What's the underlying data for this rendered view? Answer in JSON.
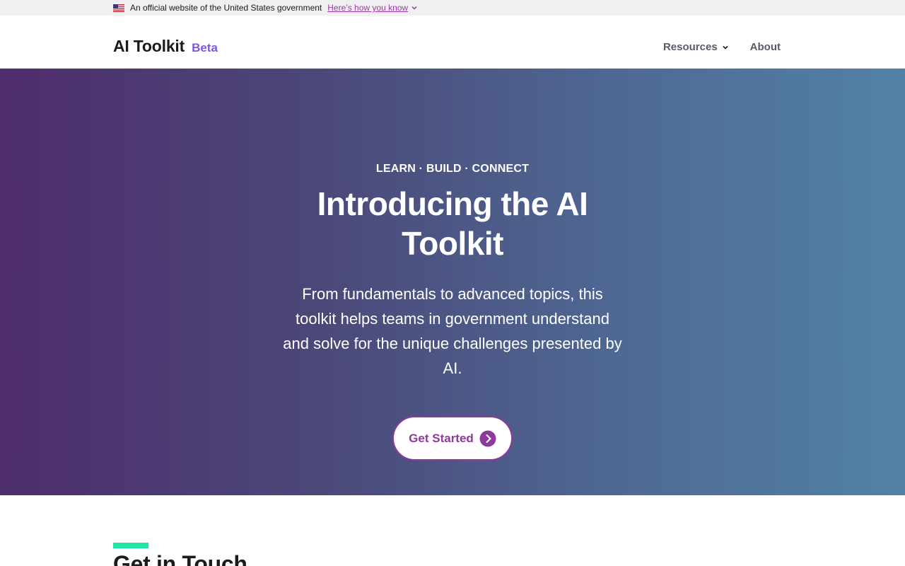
{
  "gov_banner": {
    "text": "An official website of the United States government",
    "link": "Here’s how you know",
    "flag_icon": "us-flag-icon",
    "chevron_icon": "chevron-down-icon"
  },
  "header": {
    "title": "AI Toolkit",
    "badge": "Beta",
    "nav": [
      {
        "label": "Resources",
        "icon": "chevron-down-icon"
      },
      {
        "label": "About"
      }
    ]
  },
  "hero": {
    "eyebrow": "LEARN · BUILD · CONNECT",
    "title": "Introducing the AI Toolkit",
    "description": "From fundamentals to advanced topics, this toolkit helps teams in government understand and solve for the unique challenges presented by AI.",
    "cta_label": "Get Started",
    "cta_icon": "arrow-right-circle-icon"
  },
  "section": {
    "title": "Get in Touch"
  },
  "colors": {
    "accent_purple": "#8e3a9c",
    "badge_purple": "#7b5ad8",
    "hero_gradient_start": "#4e2d6c",
    "hero_gradient_end": "#5282a6",
    "accent_green": "#1ee8a6",
    "banner_bg": "#f0f0f0"
  }
}
